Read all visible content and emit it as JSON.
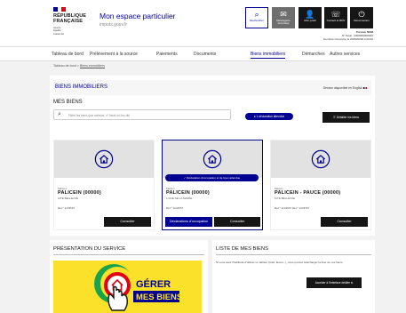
{
  "header": {
    "logo": {
      "line1": "RÉPUBLIQUE",
      "line2": "FRANÇAISE",
      "devise1": "Liberté",
      "devise2": "Égalité",
      "devise3": "Fraternité"
    },
    "service_title": "Mon espace particulier",
    "service_sub": "impots.gouv.fr",
    "buttons": [
      {
        "icon": "⌕",
        "label": "Rechercher"
      },
      {
        "icon": "✉",
        "label": "Messagerie sécurisée"
      },
      {
        "icon": "👤",
        "label": "Mon profil"
      },
      {
        "icon": "☏",
        "label": "Contact et RDV"
      },
      {
        "icon": "⏻",
        "label": "Déconnexion"
      }
    ],
    "user_name": "Prénom NOM",
    "user_fiscal": "N° fiscal : 0000000000000",
    "user_last": "Dernière connexion le 00/00/0000 à 00:00"
  },
  "nav": {
    "items": [
      "Tableau de bord",
      "Prélèvement à la source",
      "Paiements",
      "Documents",
      "Biens immobiliers",
      "Démarches",
      "Autres services"
    ],
    "active_index": 4
  },
  "breadcrumb": {
    "home": "Tableau de bord",
    "current": "Biens immobiliers"
  },
  "main": {
    "bar_title": "BIENS IMMOBILIERS",
    "lang_label": "Service disponible en English",
    "section_title": "MES BIENS",
    "search_placeholder": "Filtrer les biens (par adresse, n° fiscal ou lieu-dit)",
    "pill_label": "● 1 déclaration attendue",
    "detail_btn": "☰ Détailler les biens",
    "cards": [
      {
        "type": "Maison",
        "address": "PALICEIN (00000)",
        "town": "CITE BELLEVUE",
        "ref": "Réf.* 1234567",
        "badge": "",
        "buttons": [
          "Consulter"
        ]
      },
      {
        "type": "Maison",
        "address": "PALICEIN (00000)",
        "town": "1 RUE DE LA MAIRIE",
        "ref": "Réf.* 1234567",
        "badge": "✓ Déclaration d'occupation et de loyer attendue",
        "buttons": [
          "Déclarations d'occupation",
          "Consulter"
        ]
      },
      {
        "type": "Maison",
        "address": "PALICEIN - PAUCE (00000)",
        "town": "CITE BELLEVUE",
        "ref": "Réf.* 1234567   Réf.* 1234567",
        "badge": "",
        "buttons": [
          "Consulter"
        ]
      }
    ]
  },
  "presentation": {
    "title": "PRÉSENTATION DU SERVICE",
    "banner_line1": "GÉRER",
    "banner_line2": "MES BIENS",
    "colors": {
      "yellow": "#fbe12a",
      "red": "#e1000f",
      "blue": "#000091",
      "green": "#18a34c"
    }
  },
  "liste": {
    "title": "LISTE DE MES BIENS",
    "description": "Si vous avez l'habitude d'utiliser un tableur (Calc, Excel...), vous pouvez télécharger la liste de vos biens.",
    "button": "Accéder à l'interface dédiée ⧉"
  }
}
